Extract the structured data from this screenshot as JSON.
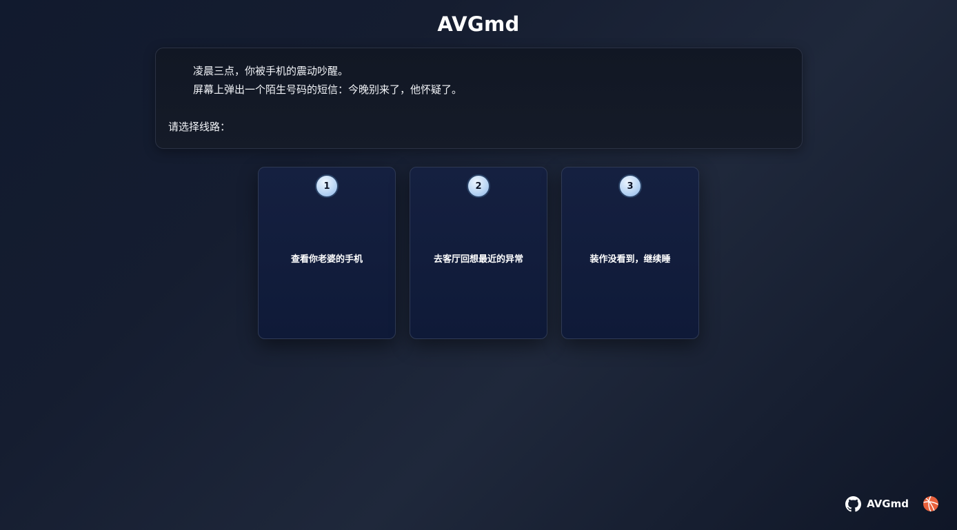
{
  "app": {
    "title": "AVGmd"
  },
  "story": {
    "lines": [
      "凌晨三点，你被手机的震动吵醒。",
      "屏幕上弹出一个陌生号码的短信：今晚别来了，他怀疑了。"
    ],
    "prompt": "请选择线路："
  },
  "choices": [
    {
      "number": "1",
      "label": "查看你老婆的手机"
    },
    {
      "number": "2",
      "label": "去客厅回想最近的异常"
    },
    {
      "number": "3",
      "label": "装作没看到，继续睡"
    }
  ],
  "footer": {
    "github_label": "AVGmd",
    "icons": [
      "github-icon",
      "dribbble-icon"
    ],
    "accent_color": "#e8613c"
  }
}
